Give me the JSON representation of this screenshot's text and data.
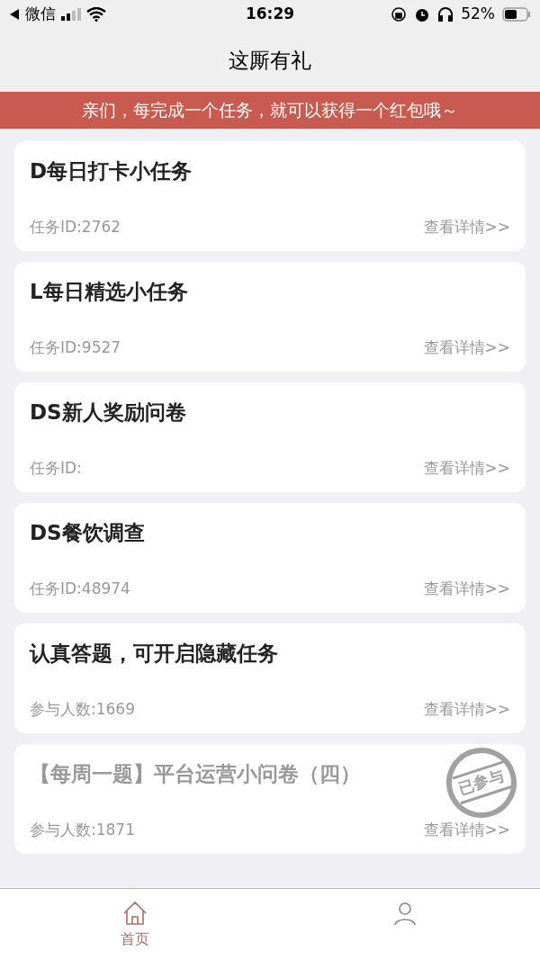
{
  "status_bar": {
    "back_label": "微信",
    "time": "16:29",
    "battery": "52%"
  },
  "title": "这厮有礼",
  "banner": "亲们，每完成一个任务，就可以获得一个红包哦～",
  "tasks": [
    {
      "title": "D每日打卡小任务",
      "meta": "任务ID:2762",
      "link": "查看详情>>",
      "participated": false
    },
    {
      "title": "L每日精选小任务",
      "meta": "任务ID:9527",
      "link": "查看详情>>",
      "participated": false
    },
    {
      "title": "DS新人奖励问卷",
      "meta": "任务ID:",
      "link": "查看详情>>",
      "participated": false
    },
    {
      "title": "DS餐饮调查",
      "meta": "任务ID:48974",
      "link": "查看详情>>",
      "participated": false
    },
    {
      "title": "认真答题，可开启隐藏任务",
      "meta": "参与人数:1669",
      "link": "查看详情>>",
      "participated": false
    },
    {
      "title": "【每周一题】平台运营小问卷（四）",
      "meta": "参与人数:1871",
      "link": "查看详情>>",
      "participated": true,
      "stamp": "已参与"
    }
  ],
  "tab_bar": [
    {
      "kind": "home",
      "label": "首页",
      "selected": true
    },
    {
      "kind": "user",
      "selected": false
    }
  ]
}
